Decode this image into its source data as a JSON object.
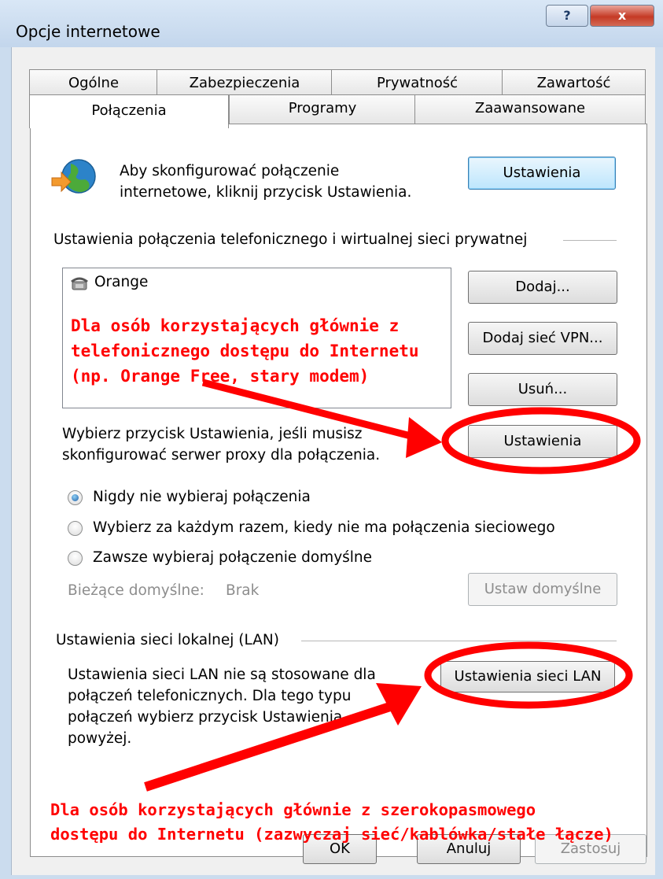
{
  "window": {
    "title": "Opcje internetowe",
    "help": "?",
    "close": "x"
  },
  "tabs_row1": [
    "Ogólne",
    "Zabezpieczenia",
    "Prywatność",
    "Zawartość"
  ],
  "tabs_row2": {
    "active": "Połączenia",
    "programs": "Programy",
    "advanced": "Zaawansowane"
  },
  "setup": {
    "text_line1": "Aby skonfigurować połączenie",
    "text_line2": "internetowe, kliknij przycisk Ustawienia.",
    "button": "Ustawienia"
  },
  "dialup": {
    "group_label": "Ustawienia połączenia telefonicznego i wirtualnej sieci prywatnej",
    "connections": [
      "Orange"
    ],
    "add_button": "Dodaj...",
    "add_vpn_button": "Dodaj sieć VPN...",
    "remove_button": "Usuń...",
    "proxy_text_line1": "Wybierz przycisk Ustawienia, jeśli musisz",
    "proxy_text_line2": "skonfigurować serwer proxy dla połączenia.",
    "settings_button": "Ustawienia",
    "radio_never": "Nigdy nie wybieraj połączenia",
    "radio_whenever": "Wybierz za każdym razem, kiedy nie ma połączenia sieciowego",
    "radio_always": "Zawsze wybieraj połączenie domyślne",
    "current_default_label": "Bieżące domyślne:",
    "current_default_value": "Brak",
    "set_default_button": "Ustaw domyślne"
  },
  "lan": {
    "group_label": "Ustawienia sieci lokalnej (LAN)",
    "text_line1": "Ustawienia sieci LAN nie są stosowane dla",
    "text_line2": "połączeń telefonicznych. Dla tego typu",
    "text_line3": "połączeń wybierz przycisk Ustawienia",
    "text_line4": "powyżej.",
    "button": "Ustawienia sieci LAN"
  },
  "footer": {
    "ok": "OK",
    "cancel": "Anuluj",
    "apply": "Zastosuj"
  },
  "annotations": {
    "dialup_line1": "Dla osób korzystających głównie z",
    "dialup_line2": "telefonicznego dostępu do Internetu",
    "dialup_line3": "(np. Orange Free, stary modem)",
    "broadband_line1": "Dla osób korzystających głównie z szerokopasmowego",
    "broadband_line2": "dostępu do Internetu (zazwyczaj sieć/kablówka/stałe łącze)"
  },
  "colors": {
    "annotation": "#ff0000",
    "default_button_border": "#3c7fb1",
    "title_bar": "#c3d6ec"
  }
}
